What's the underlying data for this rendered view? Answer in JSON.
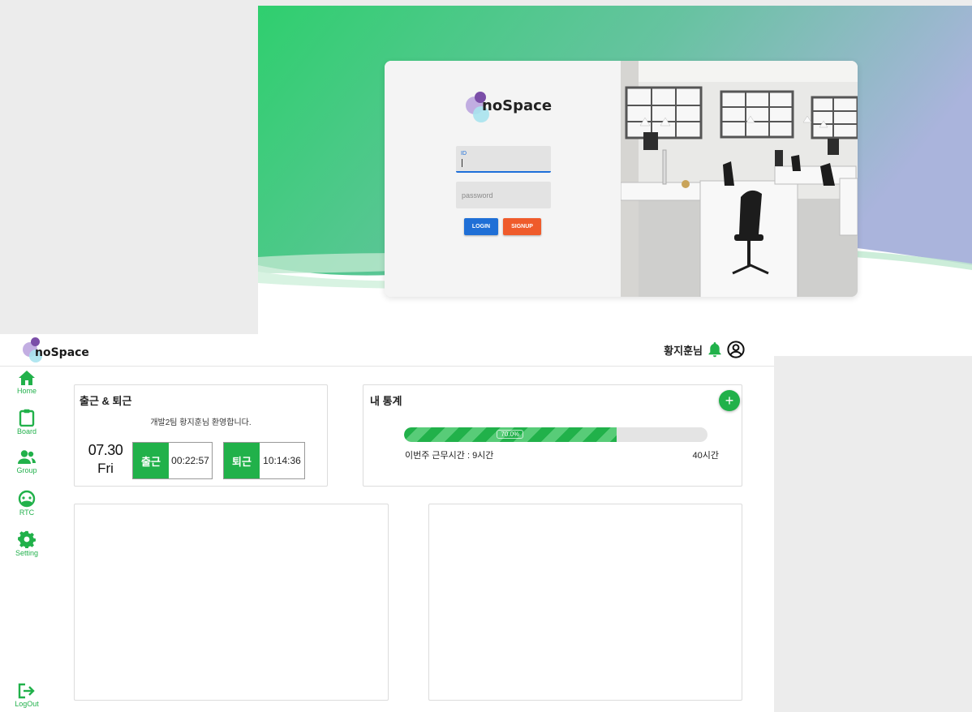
{
  "login": {
    "logo_text": "noSpace",
    "id_label": "ID",
    "password_placeholder": "password",
    "login_button": "LOGIN",
    "signup_button": "SIGNUP",
    "colors": {
      "gradient_start": "#2fcf6e",
      "gradient_end": "#a7b3dd",
      "login_button": "#1f6fd6",
      "signup_button": "#ef5b2b"
    }
  },
  "dashboard": {
    "logo_text": "noSpace",
    "header": {
      "user_name": "황지훈님",
      "icons": [
        "bell-icon",
        "account-circle-icon"
      ]
    },
    "sidebar": {
      "items": [
        {
          "label": "Home",
          "icon": "home-icon"
        },
        {
          "label": "Board",
          "icon": "clipboard-icon"
        },
        {
          "label": "Group",
          "icon": "group-icon"
        },
        {
          "label": "RTC",
          "icon": "rtc-icon"
        },
        {
          "label": "Setting",
          "icon": "gear-icon"
        }
      ],
      "logout": {
        "label": "LogOut",
        "icon": "logout-icon"
      }
    },
    "attendance": {
      "title": "출근 & 퇴근",
      "welcome": "개발2팀 황지훈님 환영합니다.",
      "date": "07.30",
      "weekday": "Fri",
      "clock_in": {
        "label": "출근",
        "time": "00:22:57"
      },
      "clock_out": {
        "label": "퇴근",
        "time": "10:14:36"
      }
    },
    "stats": {
      "title": "내 통계",
      "add_button": "+",
      "progress_label": "70.0%",
      "progress_value": 0.7,
      "week_hours": "이번주 근무시간 : 9시간",
      "goal_hours": "40시간"
    },
    "accent_color": "#21b14a"
  }
}
